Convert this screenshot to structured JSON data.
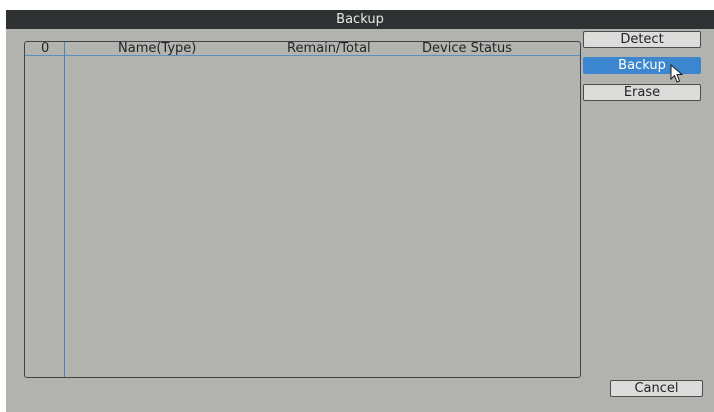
{
  "window": {
    "title": "Backup"
  },
  "table": {
    "columns": [
      "0",
      "Name(Type)",
      "Remain/Total",
      "Device Status"
    ],
    "rows": []
  },
  "buttons": {
    "detect": "Detect",
    "backup": "Backup",
    "erase": "Erase",
    "cancel": "Cancel"
  },
  "colors": {
    "titlebar": "#2f3233",
    "panel": "#b2b3ae",
    "accent": "#3b86cf",
    "grid_line": "#4d82bf"
  },
  "icons": {
    "cursor": "mouse-pointer-icon"
  }
}
